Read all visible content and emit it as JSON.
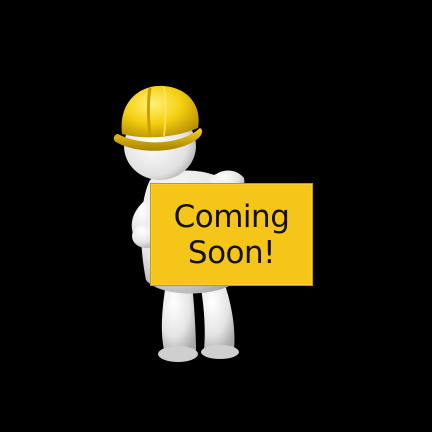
{
  "sign": {
    "line1": "Coming",
    "line2": "Soon!"
  },
  "colors": {
    "background": "#000000",
    "sign": "#f5c518",
    "helmet": "#f2c400",
    "figure": "#e6e6e6"
  },
  "icons": {
    "character": "construction-worker-figure",
    "helmet": "hard-hat-icon"
  }
}
